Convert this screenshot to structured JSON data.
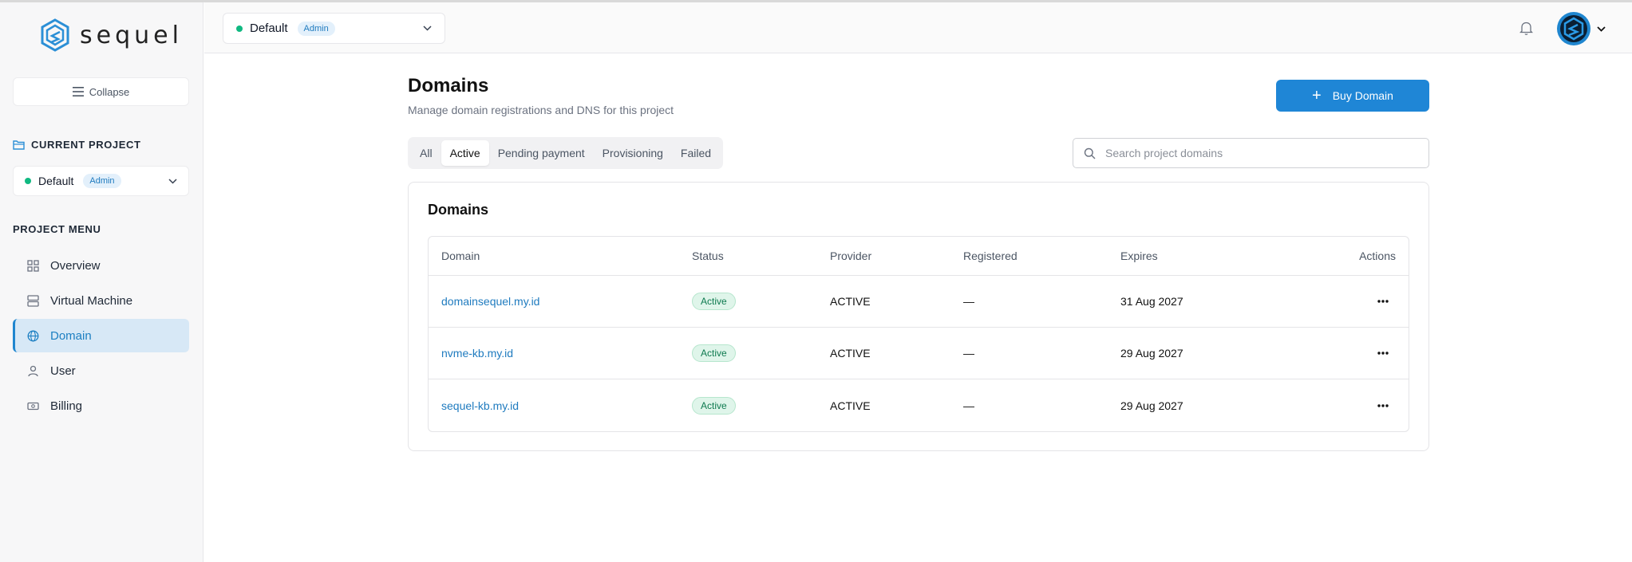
{
  "app": {
    "name": "sequel",
    "brand_color": "#1f86d6"
  },
  "sidebar": {
    "collapse_label": "Collapse",
    "current_project_title": "CURRENT PROJECT",
    "project": {
      "name": "Default",
      "role": "Admin",
      "status_color": "#10b981"
    },
    "menu_title": "PROJECT MENU",
    "items": [
      {
        "label": "Overview",
        "icon": "grid-icon",
        "active": false
      },
      {
        "label": "Virtual Machine",
        "icon": "server-icon",
        "active": false
      },
      {
        "label": "Domain",
        "icon": "globe-icon",
        "active": true
      },
      {
        "label": "User",
        "icon": "user-icon",
        "active": false
      },
      {
        "label": "Billing",
        "icon": "billing-icon",
        "active": false
      }
    ]
  },
  "topbar": {
    "project": {
      "name": "Default",
      "role": "Admin"
    },
    "icons": [
      "bell-icon",
      "avatar",
      "chevron-down-icon"
    ]
  },
  "main": {
    "title": "Domains",
    "subtitle": "Manage domain registrations and DNS for this project",
    "buy_button": "Buy Domain",
    "tabs": [
      {
        "label": "All",
        "active": false
      },
      {
        "label": "Active",
        "active": true
      },
      {
        "label": "Pending payment",
        "active": false
      },
      {
        "label": "Provisioning",
        "active": false
      },
      {
        "label": "Failed",
        "active": false
      }
    ],
    "search_placeholder": "Search project domains",
    "card_title": "Domains",
    "columns": [
      "Domain",
      "Status",
      "Provider",
      "Registered",
      "Expires",
      "Actions"
    ],
    "rows": [
      {
        "domain": "domainsequel.my.id",
        "status": "Active",
        "provider": "ACTIVE",
        "registered": "—",
        "expires": "31 Aug 2027"
      },
      {
        "domain": "nvme-kb.my.id",
        "status": "Active",
        "provider": "ACTIVE",
        "registered": "—",
        "expires": "29 Aug 2027"
      },
      {
        "domain": "sequel-kb.my.id",
        "status": "Active",
        "provider": "ACTIVE",
        "registered": "—",
        "expires": "29 Aug 2027"
      }
    ]
  }
}
